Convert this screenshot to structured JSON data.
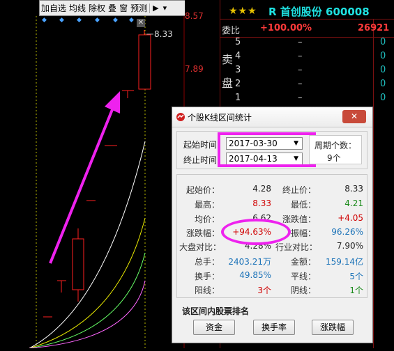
{
  "toolbar": {
    "items": [
      "加自选",
      "均线",
      "除权",
      "叠",
      "窗",
      "预测"
    ],
    "play_icon": "▶",
    "dropdown_icon": "▾"
  },
  "chart": {
    "price_high": "8.57",
    "price_mid": "7.89",
    "annotation_high": "8.33",
    "close_x": "✕"
  },
  "stock": {
    "stars": "★★★",
    "prefix": "R",
    "name": "首创股份",
    "code": "600008"
  },
  "orderbook": {
    "label_weibi": "委比",
    "weibi_pct": "+100.00%",
    "weibi_num": "26921",
    "sell_side_label_1": "卖",
    "sell_side_label_2": "盘",
    "rows": [
      {
        "level": "5",
        "price": "–",
        "vol": "0"
      },
      {
        "level": "4",
        "price": "–",
        "vol": "0"
      },
      {
        "level": "3",
        "price": "–",
        "vol": "0"
      },
      {
        "level": "2",
        "price": "–",
        "vol": "0"
      },
      {
        "level": "1",
        "price": "–",
        "vol": "0"
      }
    ]
  },
  "dialog": {
    "title": "个股K线区间统计",
    "start_label": "起始时间",
    "end_label": "终止时间",
    "start_value": "2017-03-30",
    "end_value": "2017-04-13",
    "period_label": "周期个数：",
    "period_value": "9个",
    "stats": [
      {
        "l1": "起始价：",
        "v1": "4.28",
        "c1": "#222222",
        "l2": "终止价：",
        "v2": "8.33",
        "c2": "#222222"
      },
      {
        "l1": "最高：",
        "v1": "8.33",
        "c1": "#d00000",
        "l2": "最低：",
        "v2": "4.21",
        "c2": "#1a8a1a"
      },
      {
        "l1": "均价：",
        "v1": "6.62",
        "c1": "#222222",
        "l2": "涨跌值：",
        "v2": "+4.05",
        "c2": "#d00000"
      },
      {
        "l1": "涨跌幅：",
        "v1": "+94.63%",
        "c1": "#d00000",
        "l2": "振幅：",
        "v2": "96.26%",
        "c2": "#1a72b8"
      },
      {
        "l1": "大盘对比：",
        "v1": "4.28%",
        "c1": "#222222",
        "l2": "行业对比：",
        "v2": "7.90%",
        "c2": "#222222"
      },
      {
        "l1": "总手：",
        "v1": "2403.21万",
        "c1": "#1a72b8",
        "l2": "金额：",
        "v2": "159.14亿",
        "c2": "#1a72b8"
      },
      {
        "l1": "换手：",
        "v1": "49.85%",
        "c1": "#1a72b8",
        "l2": "平线：",
        "v2": "5个",
        "c2": "#1a72b8"
      },
      {
        "l1": "阳线：",
        "v1": "3个",
        "c1": "#d00000",
        "l2": "阴线：",
        "v2": "1个",
        "c2": "#1a8a1a"
      }
    ],
    "ranking_label": "该区间内股票排名",
    "buttons": [
      "资金",
      "换手率",
      "涨跌幅"
    ]
  },
  "colors": {
    "annotation_magenta": "#ee22ee",
    "rise_red": "#ff2020",
    "fall_green": "#20c020",
    "stock_cyan": "#1fe2e2"
  }
}
